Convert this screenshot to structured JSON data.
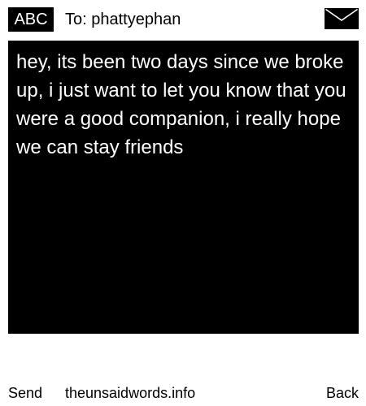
{
  "header": {
    "mode_label": "ABC",
    "recipient_label": "To: phattyephan",
    "mail_icon": "envelope-icon"
  },
  "message": {
    "text": "hey, its been two days since we broke up, i just want to let you know that you were a good companion, i really hope we can stay friends"
  },
  "footer": {
    "send_label": "Send",
    "site_label": "theunsaidwords.info",
    "back_label": "Back"
  },
  "colors": {
    "background": "#ffffff",
    "message_background": "#000000",
    "message_text": "#ffffff",
    "text": "#000000"
  }
}
